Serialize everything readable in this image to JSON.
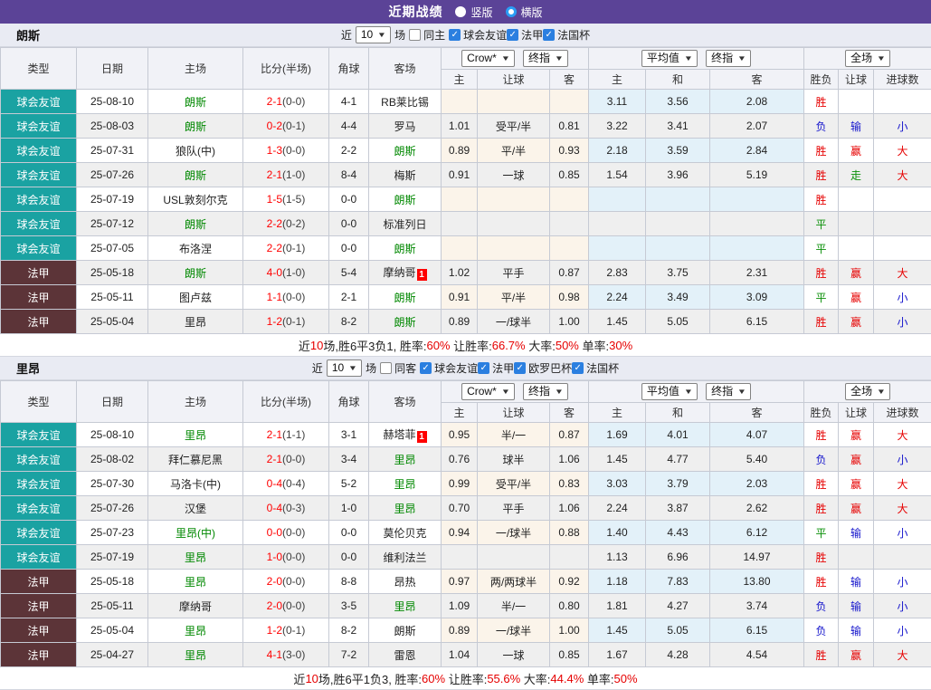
{
  "title_bar": {
    "title": "近期战绩",
    "vertical_label": "竖版",
    "horizontal_label": "横版",
    "vertical_selected": false,
    "horizontal_selected": true
  },
  "header": {
    "cols": [
      "类型",
      "日期",
      "主场",
      "比分(半场)",
      "角球",
      "客场"
    ],
    "crow_select": "Crow*",
    "crow_final_select": "终指",
    "avg_select": "平均值",
    "avg_final_select": "终指",
    "scope_select": "全场",
    "crow_sub": [
      "主",
      "让球",
      "客"
    ],
    "avg_sub": [
      "主",
      "和",
      "客"
    ],
    "result_sub": [
      "胜负",
      "让球",
      "进球数"
    ]
  },
  "colors": {
    "accent_purple": "#5b4397",
    "type_friendly_teal": "#1aa2a2",
    "type_ligue1_maroon": "#5c3438",
    "team_highlight_green": "#008800",
    "score_red": "#ff0000",
    "win_red": "#e60000",
    "draw_green": "#0a9008",
    "lose_blue": "#1515cc",
    "crow_col_bg": "#fbf4ea",
    "avg_col_bg": "#e3f1f9",
    "checkbox_blue": "#2b7fe0"
  },
  "tables": [
    {
      "team": "朗斯",
      "near_label": "近",
      "count": "10",
      "matches_label": "场",
      "same_label": "同主",
      "same_checked": false,
      "league_checkboxes": [
        {
          "label": "球会友谊",
          "checked": true
        },
        {
          "label": "法甲",
          "checked": true
        },
        {
          "label": "法国杯",
          "checked": true
        }
      ],
      "rows": [
        {
          "type": "球会友谊",
          "tc": "friendly",
          "date": "25-08-10",
          "home": "朗斯",
          "hh": true,
          "hb": "",
          "score": "2-1",
          "half": "(0-0)",
          "corner": "4-1",
          "away": "RB莱比锡",
          "ah": false,
          "ab": "",
          "crow": [
            "",
            "",
            ""
          ],
          "avg": [
            "3.11",
            "3.56",
            "2.08"
          ],
          "res": [
            "胜",
            "red"
          ],
          "lr": [
            "",
            ""
          ],
          "gr": [
            "",
            ""
          ]
        },
        {
          "type": "球会友谊",
          "tc": "friendly",
          "date": "25-08-03",
          "home": "朗斯",
          "hh": true,
          "hb": "",
          "score": "0-2",
          "half": "(0-1)",
          "corner": "4-4",
          "away": "罗马",
          "ah": false,
          "ab": "",
          "crow": [
            "1.01",
            "受平/半",
            "0.81"
          ],
          "avg": [
            "3.22",
            "3.41",
            "2.07"
          ],
          "res": [
            "负",
            "blue"
          ],
          "lr": [
            "输",
            "blue"
          ],
          "gr": [
            "小",
            "blue"
          ]
        },
        {
          "type": "球会友谊",
          "tc": "friendly",
          "date": "25-07-31",
          "home": "狼队(中)",
          "hh": false,
          "hb": "",
          "score": "1-3",
          "half": "(0-0)",
          "corner": "2-2",
          "away": "朗斯",
          "ah": true,
          "ab": "",
          "crow": [
            "0.89",
            "平/半",
            "0.93"
          ],
          "avg": [
            "2.18",
            "3.59",
            "2.84"
          ],
          "res": [
            "胜",
            "red"
          ],
          "lr": [
            "赢",
            "red"
          ],
          "gr": [
            "大",
            "red"
          ]
        },
        {
          "type": "球会友谊",
          "tc": "friendly",
          "date": "25-07-26",
          "home": "朗斯",
          "hh": true,
          "hb": "",
          "score": "2-1",
          "half": "(1-0)",
          "corner": "8-4",
          "away": "梅斯",
          "ah": false,
          "ab": "",
          "crow": [
            "0.91",
            "一球",
            "0.85"
          ],
          "avg": [
            "1.54",
            "3.96",
            "5.19"
          ],
          "res": [
            "胜",
            "red"
          ],
          "lr": [
            "走",
            "green"
          ],
          "gr": [
            "大",
            "red"
          ]
        },
        {
          "type": "球会友谊",
          "tc": "friendly",
          "date": "25-07-19",
          "home": "USL敦刻尔克",
          "hh": false,
          "hb": "",
          "score": "1-5",
          "half": "(1-5)",
          "corner": "0-0",
          "away": "朗斯",
          "ah": true,
          "ab": "",
          "crow": [
            "",
            "",
            ""
          ],
          "avg": [
            "",
            "",
            ""
          ],
          "res": [
            "胜",
            "red"
          ],
          "lr": [
            "",
            ""
          ],
          "gr": [
            "",
            ""
          ]
        },
        {
          "type": "球会友谊",
          "tc": "friendly",
          "date": "25-07-12",
          "home": "朗斯",
          "hh": true,
          "hb": "",
          "score": "2-2",
          "half": "(0-2)",
          "corner": "0-0",
          "away": "标准列日",
          "ah": false,
          "ab": "",
          "crow": [
            "",
            "",
            ""
          ],
          "avg": [
            "",
            "",
            ""
          ],
          "res": [
            "平",
            "green"
          ],
          "lr": [
            "",
            ""
          ],
          "gr": [
            "",
            ""
          ]
        },
        {
          "type": "球会友谊",
          "tc": "friendly",
          "date": "25-07-05",
          "home": "布洛涅",
          "hh": false,
          "hb": "",
          "score": "2-2",
          "half": "(0-1)",
          "corner": "0-0",
          "away": "朗斯",
          "ah": true,
          "ab": "",
          "crow": [
            "",
            "",
            ""
          ],
          "avg": [
            "",
            "",
            ""
          ],
          "res": [
            "平",
            "green"
          ],
          "lr": [
            "",
            ""
          ],
          "gr": [
            "",
            ""
          ]
        },
        {
          "type": "法甲",
          "tc": "ligue1",
          "date": "25-05-18",
          "home": "朗斯",
          "hh": true,
          "hb": "",
          "score": "4-0",
          "half": "(1-0)",
          "corner": "5-4",
          "away": "摩纳哥",
          "ah": false,
          "ab": "1",
          "crow": [
            "1.02",
            "平手",
            "0.87"
          ],
          "avg": [
            "2.83",
            "3.75",
            "2.31"
          ],
          "res": [
            "胜",
            "red"
          ],
          "lr": [
            "赢",
            "red"
          ],
          "gr": [
            "大",
            "red"
          ]
        },
        {
          "type": "法甲",
          "tc": "ligue1",
          "date": "25-05-11",
          "home": "图卢兹",
          "hh": false,
          "hb": "",
          "score": "1-1",
          "half": "(0-0)",
          "corner": "2-1",
          "away": "朗斯",
          "ah": true,
          "ab": "",
          "crow": [
            "0.91",
            "平/半",
            "0.98"
          ],
          "avg": [
            "2.24",
            "3.49",
            "3.09"
          ],
          "res": [
            "平",
            "green"
          ],
          "lr": [
            "赢",
            "red"
          ],
          "gr": [
            "小",
            "blue"
          ]
        },
        {
          "type": "法甲",
          "tc": "ligue1",
          "date": "25-05-04",
          "home": "里昂",
          "hh": false,
          "hb": "",
          "score": "1-2",
          "half": "(0-1)",
          "corner": "8-2",
          "away": "朗斯",
          "ah": true,
          "ab": "",
          "crow": [
            "0.89",
            "一/球半",
            "1.00"
          ],
          "avg": [
            "1.45",
            "5.05",
            "6.15"
          ],
          "res": [
            "胜",
            "red"
          ],
          "lr": [
            "赢",
            "red"
          ],
          "gr": [
            "小",
            "blue"
          ]
        }
      ],
      "summary": [
        {
          "t": "近",
          "red": false
        },
        {
          "t": "10",
          "red": true
        },
        {
          "t": "场,胜6平3负1, 胜率:",
          "red": false
        },
        {
          "t": "60%",
          "red": true
        },
        {
          "t": " 让胜率:",
          "red": false
        },
        {
          "t": "66.7%",
          "red": true
        },
        {
          "t": " 大率:",
          "red": false
        },
        {
          "t": "50%",
          "red": true
        },
        {
          "t": " 单率:",
          "red": false
        },
        {
          "t": "30%",
          "red": true
        }
      ]
    },
    {
      "team": "里昂",
      "near_label": "近",
      "count": "10",
      "matches_label": "场",
      "same_label": "同客",
      "same_checked": false,
      "league_checkboxes": [
        {
          "label": "球会友谊",
          "checked": true
        },
        {
          "label": "法甲",
          "checked": true
        },
        {
          "label": "欧罗巴杯",
          "checked": true
        },
        {
          "label": "法国杯",
          "checked": true
        }
      ],
      "rows": [
        {
          "type": "球会友谊",
          "tc": "friendly",
          "date": "25-08-10",
          "home": "里昂",
          "hh": true,
          "hb": "",
          "score": "2-1",
          "half": "(1-1)",
          "corner": "3-1",
          "away": "赫塔菲",
          "ah": false,
          "ab": "1",
          "crow": [
            "0.95",
            "半/一",
            "0.87"
          ],
          "avg": [
            "1.69",
            "4.01",
            "4.07"
          ],
          "res": [
            "胜",
            "red"
          ],
          "lr": [
            "赢",
            "red"
          ],
          "gr": [
            "大",
            "red"
          ]
        },
        {
          "type": "球会友谊",
          "tc": "friendly",
          "date": "25-08-02",
          "home": "拜仁慕尼黑",
          "hh": false,
          "hb": "",
          "score": "2-1",
          "half": "(0-0)",
          "corner": "3-4",
          "away": "里昂",
          "ah": true,
          "ab": "",
          "crow": [
            "0.76",
            "球半",
            "1.06"
          ],
          "avg": [
            "1.45",
            "4.77",
            "5.40"
          ],
          "res": [
            "负",
            "blue"
          ],
          "lr": [
            "赢",
            "red"
          ],
          "gr": [
            "小",
            "blue"
          ]
        },
        {
          "type": "球会友谊",
          "tc": "friendly",
          "date": "25-07-30",
          "home": "马洛卡(中)",
          "hh": false,
          "hb": "",
          "score": "0-4",
          "half": "(0-4)",
          "corner": "5-2",
          "away": "里昂",
          "ah": true,
          "ab": "",
          "crow": [
            "0.99",
            "受平/半",
            "0.83"
          ],
          "avg": [
            "3.03",
            "3.79",
            "2.03"
          ],
          "res": [
            "胜",
            "red"
          ],
          "lr": [
            "赢",
            "red"
          ],
          "gr": [
            "大",
            "red"
          ]
        },
        {
          "type": "球会友谊",
          "tc": "friendly",
          "date": "25-07-26",
          "home": "汉堡",
          "hh": false,
          "hb": "",
          "score": "0-4",
          "half": "(0-3)",
          "corner": "1-0",
          "away": "里昂",
          "ah": true,
          "ab": "",
          "crow": [
            "0.70",
            "平手",
            "1.06"
          ],
          "avg": [
            "2.24",
            "3.87",
            "2.62"
          ],
          "res": [
            "胜",
            "red"
          ],
          "lr": [
            "赢",
            "red"
          ],
          "gr": [
            "大",
            "red"
          ]
        },
        {
          "type": "球会友谊",
          "tc": "friendly",
          "date": "25-07-23",
          "home": "里昂(中)",
          "hh": true,
          "hb": "",
          "score": "0-0",
          "half": "(0-0)",
          "corner": "0-0",
          "away": "莫伦贝克",
          "ah": false,
          "ab": "",
          "crow": [
            "0.94",
            "一/球半",
            "0.88"
          ],
          "avg": [
            "1.40",
            "4.43",
            "6.12"
          ],
          "res": [
            "平",
            "green"
          ],
          "lr": [
            "输",
            "blue"
          ],
          "gr": [
            "小",
            "blue"
          ]
        },
        {
          "type": "球会友谊",
          "tc": "friendly",
          "date": "25-07-19",
          "home": "里昂",
          "hh": true,
          "hb": "",
          "score": "1-0",
          "half": "(0-0)",
          "corner": "0-0",
          "away": "维利法兰",
          "ah": false,
          "ab": "",
          "crow": [
            "",
            "",
            ""
          ],
          "avg": [
            "1.13",
            "6.96",
            "14.97"
          ],
          "res": [
            "胜",
            "red"
          ],
          "lr": [
            "",
            ""
          ],
          "gr": [
            "",
            ""
          ]
        },
        {
          "type": "法甲",
          "tc": "ligue1",
          "date": "25-05-18",
          "home": "里昂",
          "hh": true,
          "hb": "",
          "score": "2-0",
          "half": "(0-0)",
          "corner": "8-8",
          "away": "昂热",
          "ah": false,
          "ab": "",
          "crow": [
            "0.97",
            "两/两球半",
            "0.92"
          ],
          "avg": [
            "1.18",
            "7.83",
            "13.80"
          ],
          "res": [
            "胜",
            "red"
          ],
          "lr": [
            "输",
            "blue"
          ],
          "gr": [
            "小",
            "blue"
          ]
        },
        {
          "type": "法甲",
          "tc": "ligue1",
          "date": "25-05-11",
          "home": "摩纳哥",
          "hh": false,
          "hb": "",
          "score": "2-0",
          "half": "(0-0)",
          "corner": "3-5",
          "away": "里昂",
          "ah": true,
          "ab": "",
          "crow": [
            "1.09",
            "半/一",
            "0.80"
          ],
          "avg": [
            "1.81",
            "4.27",
            "3.74"
          ],
          "res": [
            "负",
            "blue"
          ],
          "lr": [
            "输",
            "blue"
          ],
          "gr": [
            "小",
            "blue"
          ]
        },
        {
          "type": "法甲",
          "tc": "ligue1",
          "date": "25-05-04",
          "home": "里昂",
          "hh": true,
          "hb": "",
          "score": "1-2",
          "half": "(0-1)",
          "corner": "8-2",
          "away": "朗斯",
          "ah": false,
          "ab": "",
          "crow": [
            "0.89",
            "一/球半",
            "1.00"
          ],
          "avg": [
            "1.45",
            "5.05",
            "6.15"
          ],
          "res": [
            "负",
            "blue"
          ],
          "lr": [
            "输",
            "blue"
          ],
          "gr": [
            "小",
            "blue"
          ]
        },
        {
          "type": "法甲",
          "tc": "ligue1",
          "date": "25-04-27",
          "home": "里昂",
          "hh": true,
          "hb": "",
          "score": "4-1",
          "half": "(3-0)",
          "corner": "7-2",
          "away": "雷恩",
          "ah": false,
          "ab": "",
          "crow": [
            "1.04",
            "一球",
            "0.85"
          ],
          "avg": [
            "1.67",
            "4.28",
            "4.54"
          ],
          "res": [
            "胜",
            "red"
          ],
          "lr": [
            "赢",
            "red"
          ],
          "gr": [
            "大",
            "red"
          ]
        }
      ],
      "summary": [
        {
          "t": "近",
          "red": false
        },
        {
          "t": "10",
          "red": true
        },
        {
          "t": "场,胜6平1负3, 胜率:",
          "red": false
        },
        {
          "t": "60%",
          "red": true
        },
        {
          "t": " 让胜率:",
          "red": false
        },
        {
          "t": "55.6%",
          "red": true
        },
        {
          "t": " 大率:",
          "red": false
        },
        {
          "t": "44.4%",
          "red": true
        },
        {
          "t": " 单率:",
          "red": false
        },
        {
          "t": "50%",
          "red": true
        }
      ]
    }
  ]
}
